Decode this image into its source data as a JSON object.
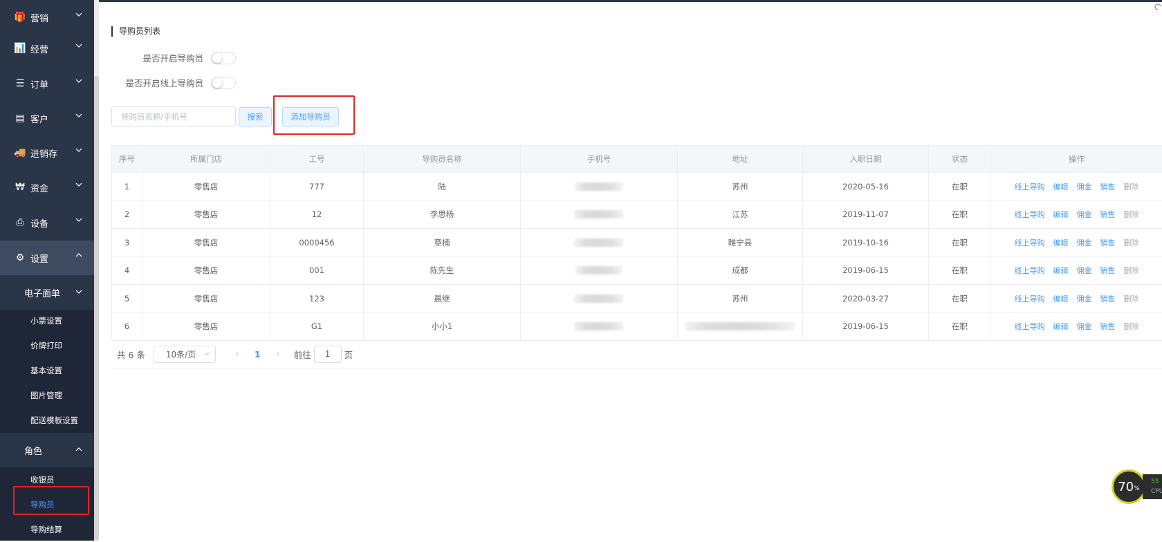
{
  "sidebar": {
    "items": [
      {
        "label": "营销",
        "icon": "gift-icon",
        "glyph": "🎁"
      },
      {
        "label": "经营",
        "icon": "bar-chart-icon",
        "glyph": "📊"
      },
      {
        "label": "订单",
        "icon": "list-icon",
        "glyph": "☰"
      },
      {
        "label": "客户",
        "icon": "id-card-icon",
        "glyph": "▤"
      },
      {
        "label": "进销存",
        "icon": "truck-icon",
        "glyph": "🚚"
      },
      {
        "label": "资金",
        "icon": "won-icon",
        "glyph": "₩"
      },
      {
        "label": "设备",
        "icon": "printer-icon",
        "glyph": "⎙"
      },
      {
        "label": "设置",
        "icon": "gear-icon",
        "glyph": "⚙"
      }
    ],
    "submenu1": {
      "label": "电子面单",
      "items": [
        "小票设置",
        "价牌打印",
        "基本设置",
        "图片管理",
        "配送模板设置"
      ]
    },
    "submenu2": {
      "label": "角色",
      "items": [
        "收银员",
        "导购员",
        "导购结算"
      ]
    }
  },
  "page": {
    "title": "导购员列表",
    "switch1_label": "是否开启导购员",
    "switch2_label": "是否开启线上导购员",
    "search_placeholder": "导购员名称/手机号",
    "search_button": "搜索",
    "add_button": "添加导购员"
  },
  "table": {
    "headers": [
      "序号",
      "所属门店",
      "工号",
      "导购员名称",
      "手机号",
      "地址",
      "入职日期",
      "状态",
      "操作"
    ],
    "rows": [
      {
        "no": "1",
        "store": "零售店",
        "id": "777",
        "name": "陆",
        "addr": "苏州",
        "date": "2020-05-16",
        "status": "在职"
      },
      {
        "no": "2",
        "store": "零售店",
        "id": "12",
        "name": "李思杨",
        "addr": "江苏",
        "date": "2019-11-07",
        "status": "在职"
      },
      {
        "no": "3",
        "store": "零售店",
        "id": "0000456",
        "name": "章楠",
        "addr": "睢宁县",
        "date": "2019-10-16",
        "status": "在职"
      },
      {
        "no": "4",
        "store": "零售店",
        "id": "001",
        "name": "陈先生",
        "addr": "成都",
        "date": "2019-06-15",
        "status": "在职"
      },
      {
        "no": "5",
        "store": "零售店",
        "id": "123",
        "name": "晨继",
        "addr": "苏州",
        "date": "2020-03-27",
        "status": "在职"
      },
      {
        "no": "6",
        "store": "零售店",
        "id": "G1",
        "name": "小小1",
        "addr": "",
        "date": "2019-06-15",
        "status": "在职"
      }
    ],
    "ops": [
      "线上导购",
      "编辑",
      "佣金",
      "销售",
      "删除"
    ]
  },
  "pager": {
    "total": "共 6 条",
    "page_size": "10条/页",
    "current": "1",
    "goto_label": "前往",
    "goto_value": "1",
    "page_suffix": "页"
  },
  "cpu": {
    "percent": "70",
    "unit": "%",
    "side_value": "55",
    "side_label": "CPU"
  },
  "colors": {
    "sidebar_bg": "#2b3548",
    "accent": "#409eff",
    "highlight": "#e62222"
  }
}
